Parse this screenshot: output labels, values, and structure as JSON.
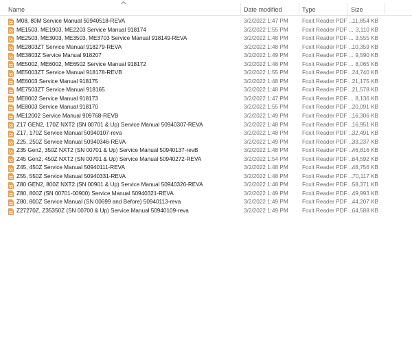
{
  "columns": {
    "name": "Name",
    "date": "Date modified",
    "type": "Type",
    "size": "Size"
  },
  "icon": "pdf-file-icon",
  "files": [
    {
      "name": "M08, 80M Service Manual 50940518-REVA",
      "date": "3/2/2022 1:47 PM",
      "type": "Foxit Reader PDF ...",
      "size": "11,854 KB"
    },
    {
      "name": "ME1503, ME1903, ME2203 Service Manual 918174",
      "date": "3/2/2022 1:55 PM",
      "type": "Foxit Reader PDF ...",
      "size": "3,110 KB"
    },
    {
      "name": "ME2503, ME3003, ME3503, ME3703 Service Manual 918149-REVA",
      "date": "3/2/2022 1:48 PM",
      "type": "Foxit Reader PDF ...",
      "size": "3,555 KB"
    },
    {
      "name": "ME2803ZT Service Manual 918279-REVA",
      "date": "3/2/2022 1:48 PM",
      "type": "Foxit Reader PDF ...",
      "size": "10,359 KB"
    },
    {
      "name": "ME3803Z Service Manual 918207",
      "date": "3/2/2022 1:49 PM",
      "type": "Foxit Reader PDF ...",
      "size": "9,590 KB"
    },
    {
      "name": "ME5002, ME6002, ME6502 Service Manual 918172",
      "date": "3/2/2022 1:48 PM",
      "type": "Foxit Reader PDF ...",
      "size": "8,065 KB"
    },
    {
      "name": "ME5003ZT Service Manual 918178-REVB",
      "date": "3/2/2022 1:55 PM",
      "type": "Foxit Reader PDF ...",
      "size": "24,740 KB"
    },
    {
      "name": "ME6003 Service Manual 918175",
      "date": "3/2/2022 1:48 PM",
      "type": "Foxit Reader PDF ...",
      "size": "21,175 KB"
    },
    {
      "name": "ME7503ZT Service Manual 918165",
      "date": "3/2/2022 1:48 PM",
      "type": "Foxit Reader PDF ...",
      "size": "21,578 KB"
    },
    {
      "name": "ME8002 Service Manual 918173",
      "date": "3/2/2022 1:47 PM",
      "type": "Foxit Reader PDF ...",
      "size": "8,136 KB"
    },
    {
      "name": "ME8003 Service Manual 918170",
      "date": "3/2/2022 1:55 PM",
      "type": "Foxit Reader PDF ...",
      "size": "20,091 KB"
    },
    {
      "name": "ME12002 Service Manual 909768-REVB",
      "date": "3/2/2022 1:49 PM",
      "type": "Foxit Reader PDF ...",
      "size": "16,306 KB"
    },
    {
      "name": "Z17 GEN2, 170Z NXT2 (SN 00701 & Up) Service Manual 50940307-REVA",
      "date": "3/2/2022 1:48 PM",
      "type": "Foxit Reader PDF ...",
      "size": "16,951 KB"
    },
    {
      "name": "Z17, 170Z Service Manual 50940107-reva",
      "date": "3/2/2022 1:48 PM",
      "type": "Foxit Reader PDF ...",
      "size": "32,491 KB"
    },
    {
      "name": "Z25, 250Z Service Manual 50940346-REVA",
      "date": "3/2/2022 1:49 PM",
      "type": "Foxit Reader PDF ...",
      "size": "33,237 KB"
    },
    {
      "name": "Z35 Gen2, 350Z NXT2 (SN 00701 & Up) Service Manual 50940137-revB",
      "date": "3/2/2022 1:48 PM",
      "type": "Foxit Reader PDF ...",
      "size": "46,816 KB"
    },
    {
      "name": "Z45 Gen2, 450Z NXT2 (SN 00701 & Up) Service Manual 50940272-REVA",
      "date": "3/2/2022 1:54 PM",
      "type": "Foxit Reader PDF ...",
      "size": "64,592 KB"
    },
    {
      "name": "Z45, 450Z Service Manual 50940111-REVA",
      "date": "3/2/2022 1:48 PM",
      "type": "Foxit Reader PDF ...",
      "size": "48,756 KB"
    },
    {
      "name": "Z55, 550Z Service Manual 50940331-REVA",
      "date": "3/2/2022 1:48 PM",
      "type": "Foxit Reader PDF ...",
      "size": "70,117 KB"
    },
    {
      "name": "Z80 GEN2, 800Z NXT2 (SN 00901 & Up) Service Manual 50940326-REVA",
      "date": "3/2/2022 1:48 PM",
      "type": "Foxit Reader PDF ...",
      "size": "58,371 KB"
    },
    {
      "name": "Z80, 800Z (SN 00701-00900) Service Manual 50940321-REVA",
      "date": "3/2/2022 1:49 PM",
      "type": "Foxit Reader PDF ...",
      "size": "49,993 KB"
    },
    {
      "name": "Z80, 800Z Service Manual (SN 00699 and Before) 50940113-reva",
      "date": "3/2/2022 1:49 PM",
      "type": "Foxit Reader PDF ...",
      "size": "44,207 KB"
    },
    {
      "name": "Z27270Z, Z35350Z (SN 00700 & Up) Service Manual 50940109-reva",
      "date": "3/2/2022 1:49 PM",
      "type": "Foxit Reader PDF ...",
      "size": "64,588 KB"
    }
  ]
}
